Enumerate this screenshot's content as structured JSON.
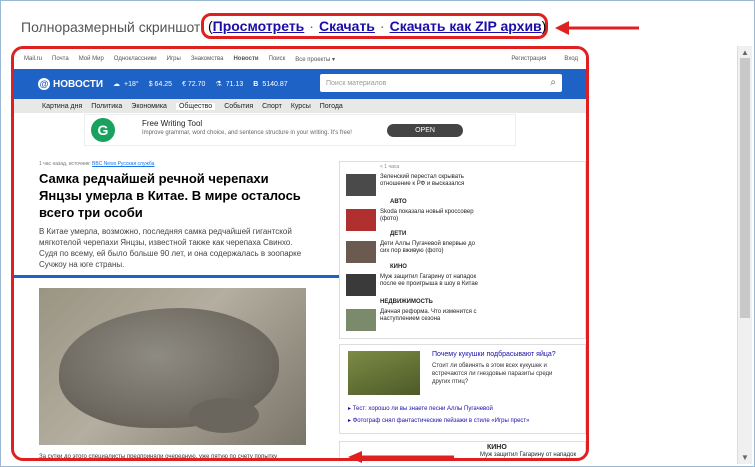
{
  "top": {
    "label": "Полноразмерный скриншот:",
    "links": [
      "Просмотреть",
      "Скачать",
      "Скачать как ZIP архив"
    ],
    "open_paren": "(",
    "close_paren": ")",
    "separator": "·"
  },
  "portal": {
    "items": [
      "Mail.ru",
      "Почта",
      "Мой Мир",
      "Одноклассники",
      "Игры",
      "Знакомства",
      "Новости",
      "Поиск",
      "Все проекты ▾"
    ],
    "right": [
      "Регистрация",
      "Вход"
    ]
  },
  "header": {
    "logo_text": "НОВОСТИ",
    "weather": "+18°",
    "ticker": [
      "$ 64.25",
      "€ 72.70",
      "71.13",
      "5140.87"
    ],
    "search_placeholder": "Поиск материалов"
  },
  "nav": {
    "items": [
      "Картина дня",
      "Политика",
      "Экономика",
      "Общество",
      "События",
      "Спорт",
      "Курсы",
      "Погода"
    ],
    "active": "Общество"
  },
  "ad": {
    "logo_letter": "G",
    "title": "Free Writing Tool",
    "description": "Improve grammar, word choice, and sentence structure in your writing. It's free!",
    "button": "OPEN"
  },
  "article": {
    "meta_prefix": "1 час назад, источник:",
    "meta_source": "BBC News Русская служба",
    "headline": "Самка редчайшей речной черепахи Янцзы умерла в Китае. В мире осталось всего три особи",
    "lead": "В Китае умерла, возможно, последняя самка редчайшей гигантской мягкотелой черепахи Янцзы, известной также как черепаха Свинхо. Судя по всему, ей было больше 90 лет, и она содержалась в зоопарке Сучжоу на юге страны.",
    "bottom_text": "За сутки до этого специалисты предприняли очередную, уже пятую по счету попытку"
  },
  "sidebar": {
    "time": "< 1 часа",
    "items": [
      {
        "category": "",
        "text": "Зеленский перестал скрывать отношение к РФ и высказался"
      },
      {
        "category": "АВТО",
        "text": "Skoda показала новый кроссовер (фото)"
      },
      {
        "category": "ДЕТИ",
        "text": "Дети Аллы Пугачевой впервые до сих пор вживую (фото)"
      },
      {
        "category": "КИНО",
        "text": "Муж защитил Гагарину от нападок после ее проигрыша в шоу в Китае"
      },
      {
        "category": "НЕДВИЖИМОСТЬ",
        "text": "Дачная реформа. Что изменится с наступлением сезона"
      }
    ]
  },
  "promo": {
    "title": "Почему кукушки подбрасывают яйца?",
    "desc": "Стоит ли обвинять в этом всех кукушек и встречаются ли гнездовые паразиты среди других птиц?",
    "link1": "Тест: хорошо ли вы знаете песни Аллы Пугачевой",
    "link2": "Фотограф снял фантастические пейзажи в стиле «Игры прест»"
  },
  "kino_bottom": {
    "category": "КИНО",
    "text": "Муж защитил Гагарину от нападок"
  }
}
